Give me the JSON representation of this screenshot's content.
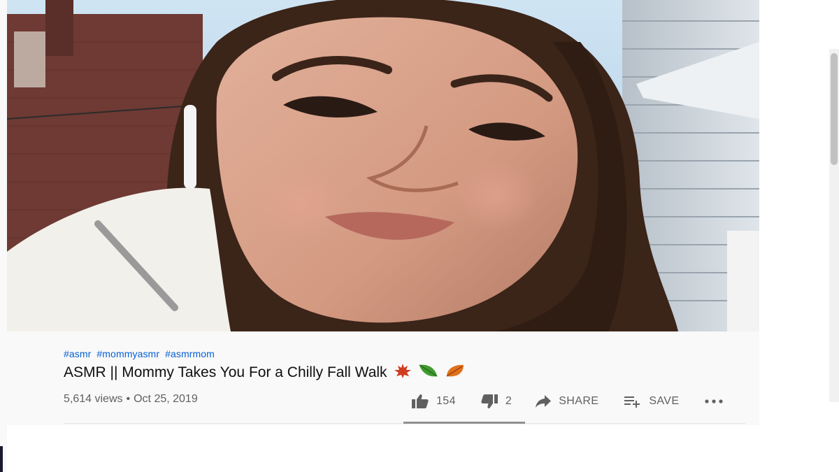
{
  "video": {
    "hashtags": [
      "#asmr",
      "#mommyasmr",
      "#asmrmom"
    ],
    "title": "ASMR || Mommy Takes You For a Chilly Fall Walk",
    "title_emoji": [
      "maple-leaf",
      "leaf",
      "fallen-leaf"
    ],
    "views": "5,614 views",
    "separator": "•",
    "date": "Oct 25, 2019"
  },
  "actions": {
    "like_count": "154",
    "dislike_count": "2",
    "share_label": "SHARE",
    "save_label": "SAVE",
    "like_ratio": 0.987
  },
  "colors": {
    "hashtag": "#065fd4",
    "text_primary": "#0f0f0f",
    "text_secondary": "#606060",
    "panel_bg": "#f9f9f9"
  }
}
